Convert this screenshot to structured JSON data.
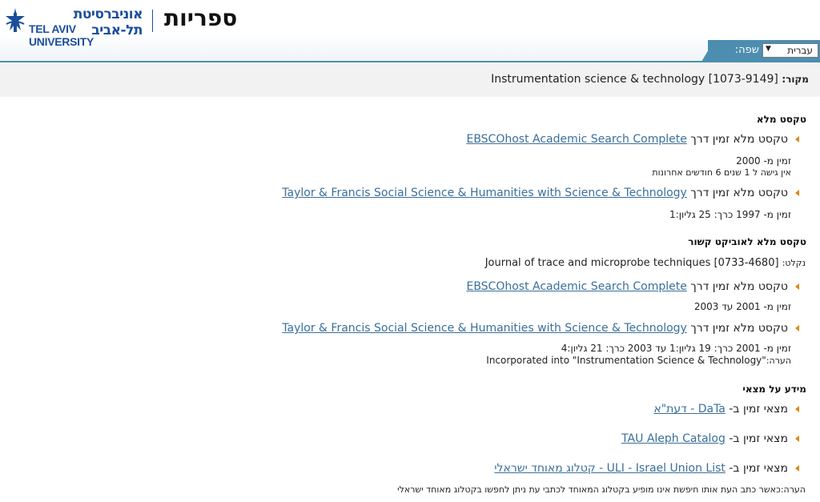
{
  "header": {
    "logo_hebrew": "אוניברסיטת תל-אביב",
    "logo_english": "TEL AVIV UNIVERSITY",
    "site_title": "ספריות",
    "language_label": "שפה:",
    "language_value": "עברית",
    "brand_color": "#1a4f9c",
    "band_color": "#4d8eb0"
  },
  "source": {
    "label": "מקור:",
    "value": "Instrumentation science & technology [1073-9149]"
  },
  "sections": {
    "fulltext": {
      "title": "טקסט מלא",
      "entries": [
        {
          "prefix": "טקסט מלא זמין דרך",
          "link": "EBSCOhost Academic Search Complete",
          "notes": [
            "זמין מ- 2000",
            "אין גישה ל 1 שנים 6 חודשים אחרונות"
          ]
        },
        {
          "prefix": "טקסט מלא זמין דרך",
          "link": "Taylor & Francis Social Science & Humanities with Science & Technology",
          "notes": [
            "זמין מ- 1997 כרך: 25 גליון:1"
          ]
        }
      ]
    },
    "related": {
      "title": "טקסט מלא לאוביקט קשור",
      "absorbed_label": "נקלט:",
      "absorbed_value": "Journal of trace and microprobe techniques [0733-4680]",
      "entries": [
        {
          "prefix": "טקסט מלא זמין דרך",
          "link": "EBSCOhost Academic Search Complete",
          "notes": [
            "זמין מ- 2001 עד 2003"
          ]
        },
        {
          "prefix": "טקסט מלא זמין דרך",
          "link": "Taylor & Francis Social Science & Humanities with Science & Technology",
          "notes": [
            "זמין מ- 2001 כרך: 19 גליון:1 עד 2003 כרך: 21 גליון:4"
          ],
          "remark_label": "הערה:",
          "remark_value": "Incorporated into \"Instrumentation Science & Technology\""
        }
      ]
    },
    "holdings": {
      "title": "מידע על מצאי",
      "entries": [
        {
          "prefix": "מצאי זמין ב-",
          "link": "DaTa - דעת\"א"
        },
        {
          "prefix": "מצאי זמין ב-",
          "link": "TAU Aleph Catalog"
        },
        {
          "prefix": "מצאי זמין ב-",
          "link": "ULI - Israel Union List - קטלוג מאוחד ישראלי"
        }
      ],
      "remark": "הערה:כאשר כתב העת אותו חיפשת אינו מופיע בקטלוג המאוחד לכתבי עת ניתן לחפשו בקטלוג מאוחד ישראלי"
    }
  },
  "colors": {
    "link": "#3a6f9a",
    "bullet": "#d98a1a"
  }
}
